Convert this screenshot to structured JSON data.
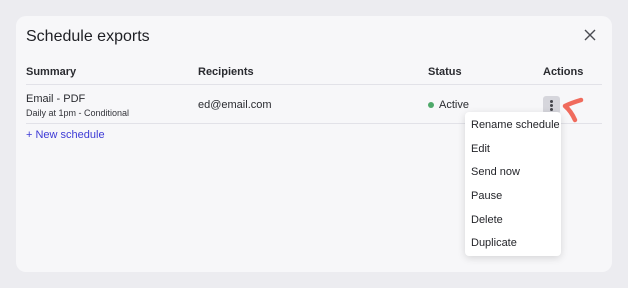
{
  "modal": {
    "title": "Schedule exports"
  },
  "table": {
    "headers": {
      "summary": "Summary",
      "recipients": "Recipients",
      "status": "Status",
      "actions": "Actions"
    },
    "rows": [
      {
        "summary": "Email - PDF",
        "summary_detail": "Daily at 1pm - Conditional",
        "recipients": "ed@email.com",
        "status": "Active",
        "status_color": "#4ea96a"
      }
    ]
  },
  "new_schedule_link": "+ New schedule",
  "actions_menu": {
    "items": [
      {
        "label": "Rename schedule"
      },
      {
        "label": "Edit"
      },
      {
        "label": "Send now"
      },
      {
        "label": "Pause"
      },
      {
        "label": "Delete"
      },
      {
        "label": "Duplicate"
      }
    ]
  },
  "icons": {
    "close": "close-icon",
    "more": "more-vertical-icon",
    "pointer": "pointer-arrow-icon"
  },
  "colors": {
    "accent": "#3d3ad6",
    "pointer": "#f06b5d"
  }
}
